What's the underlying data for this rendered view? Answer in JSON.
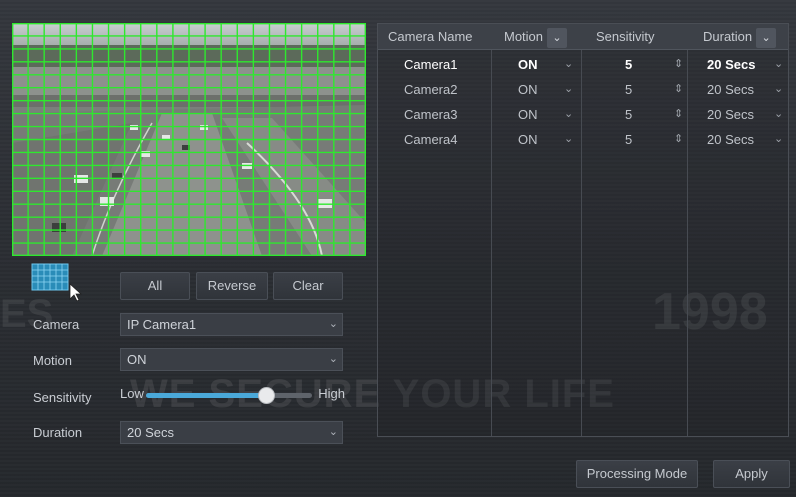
{
  "preview": {
    "grid_color": "#2ee82e"
  },
  "toolbar": {
    "all_label": "All",
    "reverse_label": "Reverse",
    "clear_label": "Clear"
  },
  "form": {
    "camera_label": "Camera",
    "camera_value": "IP Camera1",
    "motion_label": "Motion",
    "motion_value": "ON",
    "sensitivity_label": "Sensitivity",
    "sensitivity_low": "Low",
    "sensitivity_high": "High",
    "sensitivity_level": 0.72,
    "duration_label": "Duration",
    "duration_value": "20 Secs"
  },
  "table": {
    "headers": {
      "camera_name": "Camera Name",
      "motion": "Motion",
      "sensitivity": "Sensitivity",
      "duration": "Duration"
    },
    "rows": [
      {
        "name": "Camera1",
        "motion": "ON",
        "sensitivity": "5",
        "duration": "20 Secs"
      },
      {
        "name": "Camera2",
        "motion": "ON",
        "sensitivity": "5",
        "duration": "20 Secs"
      },
      {
        "name": "Camera3",
        "motion": "ON",
        "sensitivity": "5",
        "duration": "20 Secs"
      },
      {
        "name": "Camera4",
        "motion": "ON",
        "sensitivity": "5",
        "duration": "20 Secs"
      }
    ]
  },
  "footer": {
    "processing_mode_label": "Processing Mode",
    "apply_label": "Apply"
  },
  "watermark": {
    "slogan": "WE SECURE YOUR LIFE",
    "year": "1998",
    "left_text": "ES"
  },
  "colors": {
    "accent": "#4aa8d8",
    "grid": "#2ee82e"
  }
}
